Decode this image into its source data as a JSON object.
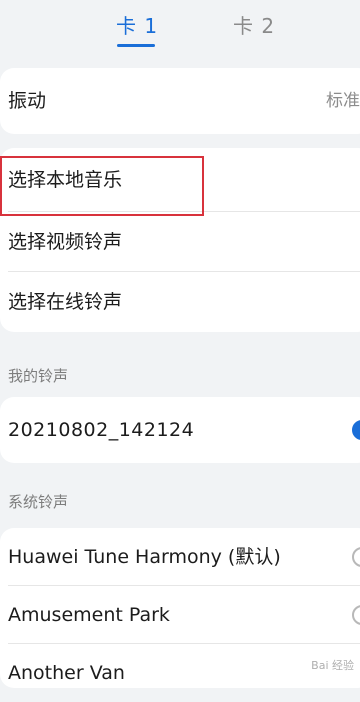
{
  "tabs": {
    "card1": "卡 1",
    "card2": "卡 2"
  },
  "vibration": {
    "label": "振动",
    "value": "标准"
  },
  "select_options": {
    "local_music": "选择本地音乐",
    "video_ringtone": "选择视频铃声",
    "online_ringtone": "选择在线铃声"
  },
  "my_ringtones": {
    "header": "我的铃声",
    "items": [
      {
        "name": "20210802_142124",
        "selected": true
      }
    ]
  },
  "system_ringtones": {
    "header": "系统铃声",
    "items": [
      {
        "name": "Huawei Tune Harmony (默认)",
        "selected": false
      },
      {
        "name": "Amusement Park",
        "selected": false
      },
      {
        "name": "Another Van",
        "selected": false
      }
    ]
  },
  "watermark": "Bai 经验",
  "colors": {
    "accent": "#1a6ed8",
    "highlight": "#d8323c",
    "background": "#f1f3f5"
  }
}
